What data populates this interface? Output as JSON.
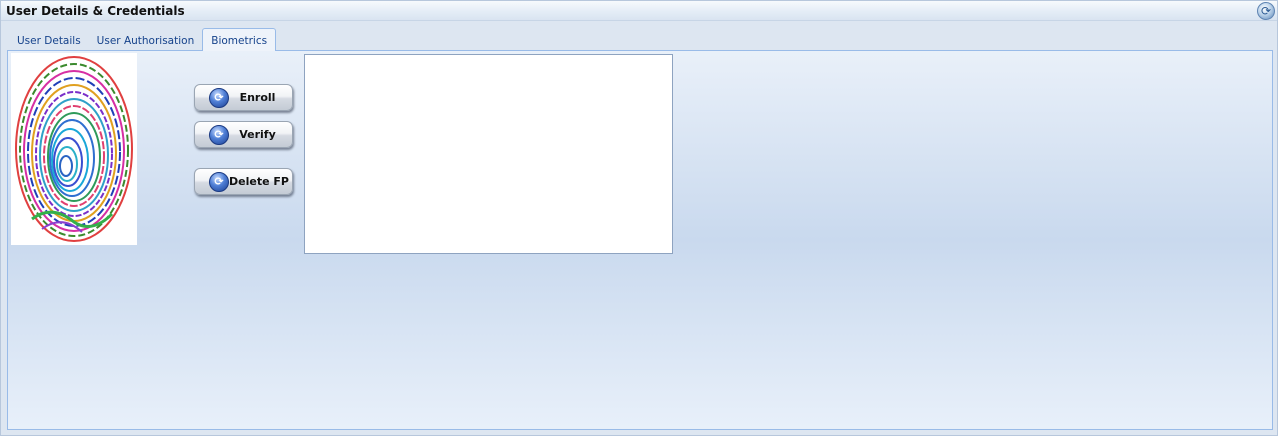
{
  "window": {
    "title": "User Details & Credentials"
  },
  "tabs": [
    {
      "label": "User Details",
      "active": false
    },
    {
      "label": "User Authorisation",
      "active": false
    },
    {
      "label": "Biometrics",
      "active": true
    }
  ],
  "biometrics": {
    "enroll_label": "Enroll",
    "verify_label": "Verify",
    "delete_label": "Delete FP"
  },
  "icons": {
    "refresh": "refresh-icon",
    "button": "refresh-arrows-icon",
    "fingerprint": "fingerprint-icon"
  },
  "colors": {
    "tab_text": "#15428b",
    "panel_border": "#99bbe8",
    "button_icon": "#2f5fbf"
  }
}
